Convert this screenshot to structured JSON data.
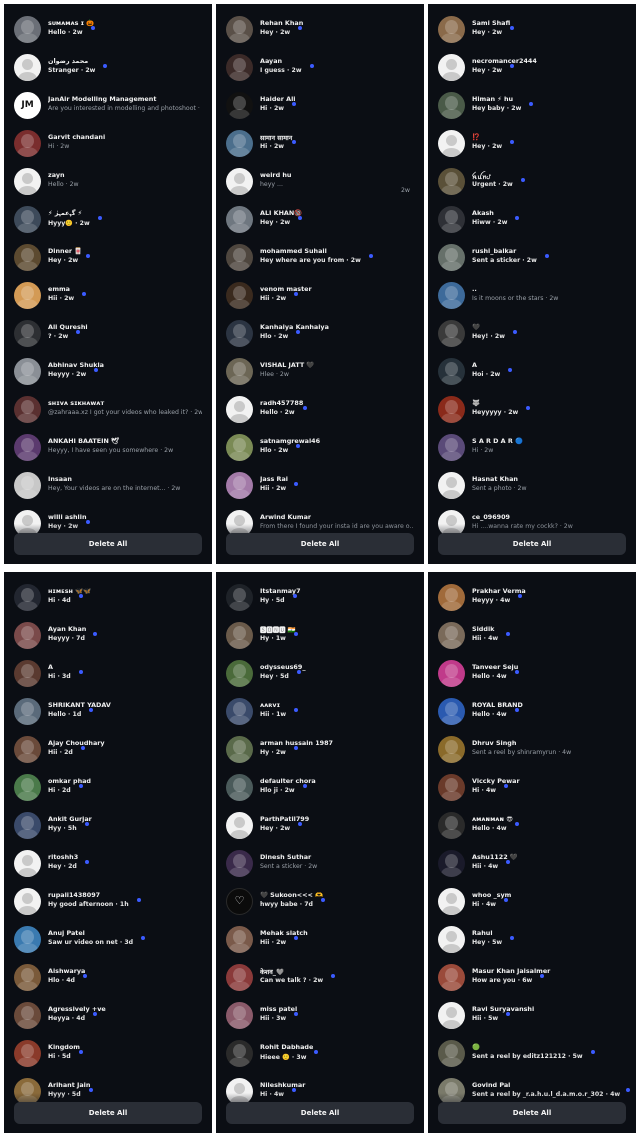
{
  "delete_all_label": "Delete All",
  "accent_color": "#3b5bff",
  "panels": [
    {
      "rows": [
        {
          "name": "ꜱᴜᴍᴀᴍᴀꜱ ɪ 🎃",
          "preview": "Hello · 2w",
          "unread": true,
          "avatar": "photo",
          "tone": "#6b6f77"
        },
        {
          "name": "محمد رضوان",
          "preview": "Stranger · 2w",
          "unread": true,
          "avatar": "default"
        },
        {
          "name": "JanAir Modelling Management",
          "preview": "Are you interested in modelling and photoshoot · 2w",
          "unread": false,
          "avatar": "logo",
          "logo_text": "JM"
        },
        {
          "name": "Garvit chandani",
          "preview": "Hi · 2w",
          "unread": false,
          "avatar": "photo",
          "tone": "#7a2d2d"
        },
        {
          "name": "zayn",
          "preview": "Hello · 2w",
          "unread": false,
          "avatar": "default"
        },
        {
          "name": "⚡ ﮔﮩﻋﻤﮩﺮٰ ⚡",
          "preview": "Hyyy🙂 · 2w",
          "unread": true,
          "avatar": "photo",
          "tone": "#3d4a5a"
        },
        {
          "name": "Dinner 🀄",
          "preview": "Hey · 2w",
          "unread": true,
          "avatar": "photo",
          "tone": "#5c4a30"
        },
        {
          "name": "emma",
          "preview": "Hii · 2w",
          "unread": true,
          "avatar": "photo",
          "tone": "#d39a55"
        },
        {
          "name": "Ali Qureshi",
          "preview": "? · 2w",
          "unread": true,
          "avatar": "photo",
          "tone": "#2d2f33"
        },
        {
          "name": "Abhinav Shukla",
          "preview": "Heyyy · 2w",
          "unread": true,
          "avatar": "photo",
          "tone": "#8a8f96"
        },
        {
          "name": "ꜱʜɪᴠᴀ ꜱɪᴋʜᴀᴡᴀᴛ",
          "preview": "@zahraaa.xz I got your videos who leaked it? · 2w",
          "unread": false,
          "avatar": "photo",
          "tone": "#5a3030"
        },
        {
          "name": "ANKAHI BAATEIN 🕊",
          "preview": "Heyyy, I have seen you somewhere · 2w",
          "unread": false,
          "avatar": "photo",
          "tone": "#5b3a6e"
        },
        {
          "name": "Insaan",
          "preview": "Hey, Your videos are on the internet... · 2w",
          "unread": false,
          "avatar": "photo",
          "tone": "#c8c8c8"
        },
        {
          "name": "willi ashlin",
          "preview": "Hey · 2w",
          "unread": true,
          "avatar": "default"
        }
      ]
    },
    {
      "rows": [
        {
          "name": "Rehan Khan",
          "preview": "Hey · 2w",
          "unread": true,
          "avatar": "photo",
          "tone": "#5a5048"
        },
        {
          "name": "Aayan",
          "preview": "I guess · 2w",
          "unread": true,
          "avatar": "photo",
          "tone": "#3b2a28"
        },
        {
          "name": "Haider Ali",
          "preview": "Hi · 2w",
          "unread": true,
          "avatar": "photo",
          "tone": "#111111"
        },
        {
          "name": "सामान सामान",
          "preview": "Hi · 2w",
          "unread": true,
          "avatar": "photo",
          "tone": "#4b6e8c"
        },
        {
          "name": "weird hu",
          "preview": "heyy ...",
          "unread": false,
          "avatar": "default",
          "trail": "2w"
        },
        {
          "name": "ALI KHAN🔞",
          "preview": "Hey · 2w",
          "unread": true,
          "avatar": "photo",
          "tone": "#6f7780"
        },
        {
          "name": "mohammed Suhail",
          "preview": "Hey where are you from · 2w",
          "unread": true,
          "avatar": "photo",
          "tone": "#4e463e"
        },
        {
          "name": "venom master",
          "preview": "Hii · 2w",
          "unread": true,
          "avatar": "photo",
          "tone": "#3a2a1e"
        },
        {
          "name": "Kanhaiya Kanhaiya",
          "preview": "Hlo · 2w",
          "unread": true,
          "avatar": "photo",
          "tone": "#2b3442"
        },
        {
          "name": "VISHAL JATT 🖤",
          "preview": "Hlee · 2w",
          "unread": false,
          "avatar": "photo",
          "tone": "#6c6655"
        },
        {
          "name": "radh457788",
          "preview": "Hello · 2w",
          "unread": true,
          "avatar": "default"
        },
        {
          "name": "satnamgrewal46",
          "preview": "Hlo · 2w",
          "unread": true,
          "avatar": "photo",
          "tone": "#7a8a55"
        },
        {
          "name": "Jass Rai",
          "preview": "Hii · 2w",
          "unread": true,
          "avatar": "photo",
          "tone": "#a37aa8"
        },
        {
          "name": "Arwind Kumar",
          "preview": "From there I found your insta id are you aware o... 2w",
          "unread": false,
          "avatar": "default"
        }
      ]
    },
    {
      "rows": [
        {
          "name": "Sami Shafi",
          "preview": "Hey · 2w",
          "unread": true,
          "avatar": "photo",
          "tone": "#8a6a4a"
        },
        {
          "name": "necromancer2444",
          "preview": "Hey · 2w",
          "unread": true,
          "avatar": "default"
        },
        {
          "name": "Himan ⚡ hu",
          "preview": "Hey baby · 2w",
          "unread": true,
          "avatar": "photo",
          "tone": "#4a5a48"
        },
        {
          "name": "⁉️",
          "preview": "Hey · 2w",
          "unread": true,
          "avatar": "default"
        },
        {
          "name": "ꫝꪊꪀᦔ",
          "preview": "Urgent · 2w",
          "unread": true,
          "avatar": "photo",
          "tone": "#5a5038"
        },
        {
          "name": "Akash",
          "preview": "Hiww · 2w",
          "unread": true,
          "avatar": "photo",
          "tone": "#2e3036"
        },
        {
          "name": "rushi_balkar",
          "preview": "Sent a sticker · 2w",
          "unread": true,
          "avatar": "photo",
          "tone": "#66706a"
        },
        {
          "name": "..",
          "preview": "Is it moons or the stars · 2w",
          "unread": false,
          "avatar": "photo",
          "tone": "#3d6a9a"
        },
        {
          "name": "🖤",
          "preview": "Hey! · 2w",
          "unread": true,
          "avatar": "photo",
          "tone": "#3a3a3a"
        },
        {
          "name": "A",
          "preview": "Hoi · 2w",
          "unread": true,
          "avatar": "photo",
          "tone": "#26313a"
        },
        {
          "name": "🐺",
          "preview": "Heyyyyy · 2w",
          "unread": true,
          "avatar": "photo",
          "tone": "#8a2a1a"
        },
        {
          "name": "S A R D A R 🔵",
          "preview": "Hi · 2w",
          "unread": false,
          "avatar": "photo",
          "tone": "#5a4a78"
        },
        {
          "name": "Hasnat Khan",
          "preview": "Sent a photo · 2w",
          "unread": false,
          "avatar": "default"
        },
        {
          "name": "ce_096909",
          "preview": "Hi ....wanna rate my cockk? · 2w",
          "unread": false,
          "avatar": "default"
        }
      ]
    },
    {
      "rows": [
        {
          "name": "ʜɪᴍᴇꜱʜ 🦋🦋",
          "preview": "Hi · 4d",
          "unread": true,
          "avatar": "photo",
          "tone": "#222630"
        },
        {
          "name": "Ayan Khan",
          "preview": "Heyyy · 7d",
          "unread": true,
          "avatar": "photo",
          "tone": "#7a4a4a"
        },
        {
          "name": "A",
          "preview": "Hi · 3d",
          "unread": true,
          "avatar": "photo",
          "tone": "#5a3a30"
        },
        {
          "name": "SHRIKANT YADAV",
          "preview": "Hello · 1d",
          "unread": true,
          "avatar": "photo",
          "tone": "#5a6a7a"
        },
        {
          "name": "Ajay Choudhary",
          "preview": "Hii · 2d",
          "unread": true,
          "avatar": "photo",
          "tone": "#6a4a3a"
        },
        {
          "name": "omkar phad",
          "preview": "Hi · 2d",
          "unread": true,
          "avatar": "photo",
          "tone": "#4a7a4a"
        },
        {
          "name": "Ankit Gurjar",
          "preview": "Hyy · 5h",
          "unread": true,
          "avatar": "photo",
          "tone": "#3a4a6a"
        },
        {
          "name": "ritoshh3",
          "preview": "Hey · 2d",
          "unread": true,
          "avatar": "default"
        },
        {
          "name": "rupali1438097",
          "preview": "Hy good afternoon · 1h",
          "unread": true,
          "avatar": "default"
        },
        {
          "name": "Anuj Patel",
          "preview": "Saw ur video on net · 3d",
          "unread": true,
          "avatar": "photo",
          "tone": "#3a7ab0"
        },
        {
          "name": "Aishwarya",
          "preview": "Hlo · 4d",
          "unread": true,
          "avatar": "photo",
          "tone": "#7a5a3a"
        },
        {
          "name": "Agressively +ve",
          "preview": "Heyya · 4d",
          "unread": true,
          "avatar": "photo",
          "tone": "#6a4a3a"
        },
        {
          "name": "Kingdom",
          "preview": "Hi · 5d",
          "unread": true,
          "avatar": "photo",
          "tone": "#8a3a2a"
        },
        {
          "name": "Arihant Jain",
          "preview": "Hyyy · 5d",
          "unread": true,
          "avatar": "photo",
          "tone": "#8a6a3a"
        }
      ]
    },
    {
      "rows": [
        {
          "name": "Itstanmay7",
          "preview": "Hy · 5d",
          "unread": true,
          "avatar": "photo",
          "tone": "#1e2228"
        },
        {
          "name": "🆂🅾🅽🆄 🇮🇳",
          "preview": "Hy · 1w",
          "unread": true,
          "avatar": "photo",
          "tone": "#6a5a4a"
        },
        {
          "name": "odysseus69_",
          "preview": "Hey · 5d",
          "unread": true,
          "avatar": "photo",
          "tone": "#4a6a3a"
        },
        {
          "name": "ᴀᴀʀᴠɪ",
          "preview": "Hii · 1w",
          "unread": true,
          "avatar": "photo",
          "tone": "#3a4a6a"
        },
        {
          "name": "arman hussain 1987",
          "preview": "Hy · 2w",
          "unread": true,
          "avatar": "photo",
          "tone": "#5a6a4a"
        },
        {
          "name": "defaulter chora",
          "preview": "Hlo ji · 2w",
          "unread": true,
          "avatar": "photo",
          "tone": "#4a5a5a"
        },
        {
          "name": "ParthPatil799",
          "preview": "Hey · 2w",
          "unread": true,
          "avatar": "default"
        },
        {
          "name": "Dinesh Suthar",
          "preview": "Sent a sticker · 2w",
          "unread": false,
          "avatar": "photo",
          "tone": "#3a2a4a"
        },
        {
          "name": "🖤 Sukoon<<< 🫶",
          "preview": "hwyy babe · 7d",
          "unread": true,
          "avatar": "heart"
        },
        {
          "name": "Mehak slatch",
          "preview": "Hii · 2w",
          "unread": true,
          "avatar": "photo",
          "tone": "#7a5a4a"
        },
        {
          "name": "केशव_🩶",
          "preview": "Can we talk ? · 2w",
          "unread": true,
          "avatar": "photo",
          "tone": "#8a3a3a"
        },
        {
          "name": "miss patel",
          "preview": "Hii · 3w",
          "unread": true,
          "avatar": "photo",
          "tone": "#8a5a6a"
        },
        {
          "name": "Rohit Dabhade",
          "preview": "Hieee 🙂 · 3w",
          "unread": true,
          "avatar": "photo",
          "tone": "#2a2a2a"
        },
        {
          "name": "Nileshkumar",
          "preview": "Hi · 4w",
          "unread": true,
          "avatar": "default"
        }
      ]
    },
    {
      "rows": [
        {
          "name": "Prakhar Verma",
          "preview": "Heyyy · 4w",
          "unread": true,
          "avatar": "photo",
          "tone": "#a06a3a"
        },
        {
          "name": "Siddik",
          "preview": "Hii · 4w",
          "unread": true,
          "avatar": "photo",
          "tone": "#7a6a5a"
        },
        {
          "name": "Tanveer Seju",
          "preview": "Hello · 4w",
          "unread": true,
          "avatar": "photo",
          "tone": "#c03a8a"
        },
        {
          "name": "ROYAL BRAND",
          "preview": "Hello · 4w",
          "unread": true,
          "avatar": "photo",
          "tone": "#2a5ab0"
        },
        {
          "name": "Dhruv Singh",
          "preview": "Sent a reel by shinramyrun · 4w",
          "unread": false,
          "avatar": "photo",
          "tone": "#8a6a2a"
        },
        {
          "name": "Viccky Pewar",
          "preview": "Hi · 4w",
          "unread": true,
          "avatar": "photo",
          "tone": "#6a3a2a"
        },
        {
          "name": "ᴀᴍᴀɴᴍᴀɴ 😎",
          "preview": "Hello · 4w",
          "unread": true,
          "avatar": "photo",
          "tone": "#2a2a2a"
        },
        {
          "name": "Ashu1122 🖤",
          "preview": "Hii · 4w",
          "unread": true,
          "avatar": "photo",
          "tone": "#1a1a2a"
        },
        {
          "name": "whoo _sym",
          "preview": "Hi · 4w",
          "unread": true,
          "avatar": "default"
        },
        {
          "name": "Rahul",
          "preview": "Hey · 5w",
          "unread": true,
          "avatar": "default"
        },
        {
          "name": "Masur Khan Jaisalmer",
          "preview": "How are you · 6w",
          "unread": true,
          "avatar": "photo",
          "tone": "#9a4a3a"
        },
        {
          "name": "Ravi Suryavanshi",
          "preview": "Hii · 5w",
          "unread": true,
          "avatar": "default"
        },
        {
          "name": "🟢",
          "preview": "Sent a reel by editz121212 · 5w",
          "unread": true,
          "avatar": "photo",
          "tone": "#5a5a4a"
        },
        {
          "name": "Govind Pal",
          "preview": "Sent a reel by _r.a.h.u.l_d.a.m.o.r_302 · 4w",
          "unread": true,
          "avatar": "photo",
          "tone": "#7a7a6a"
        }
      ]
    }
  ]
}
